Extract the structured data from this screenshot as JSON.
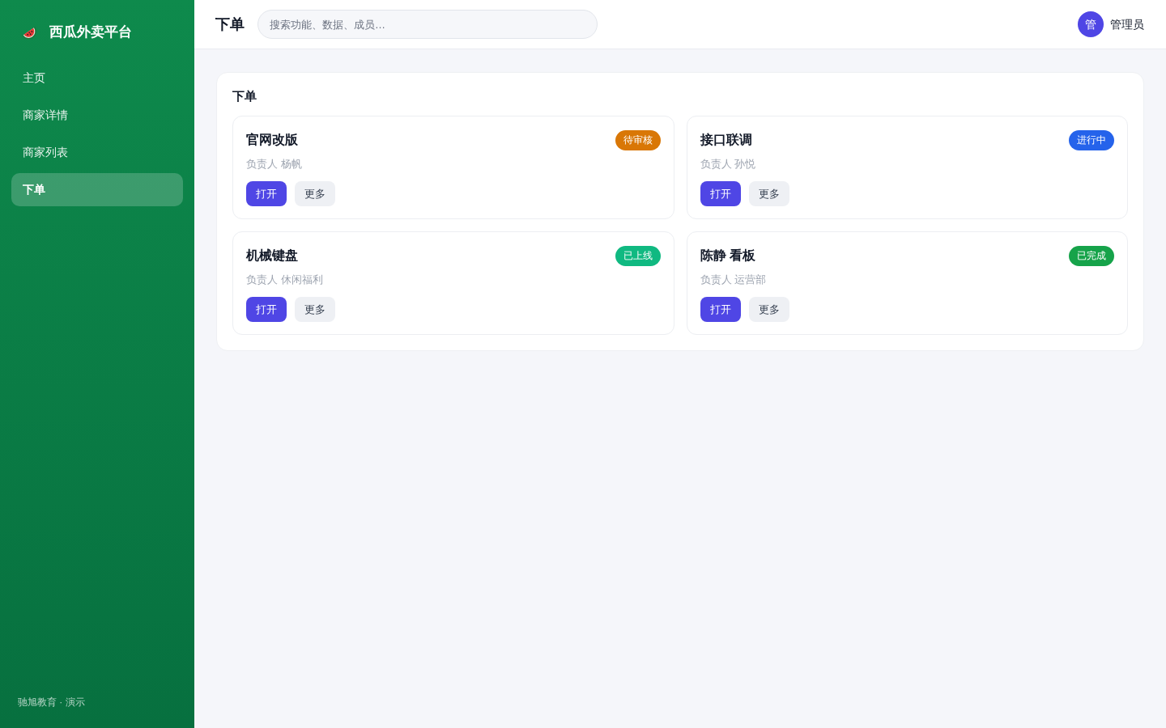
{
  "sidebar": {
    "brand": "西瓜外卖平台",
    "nav": [
      {
        "label": "主页",
        "selected": false
      },
      {
        "label": "商家详情",
        "selected": false
      },
      {
        "label": "商家列表",
        "selected": false
      },
      {
        "label": "下单",
        "selected": true
      }
    ],
    "footer": "驰旭教育 · 演示"
  },
  "header": {
    "title": "下单",
    "search": {
      "placeholder": "搜索功能、数据、成员…"
    },
    "user": {
      "avatar": "管",
      "name": "管理员"
    }
  },
  "panel": {
    "title": "下单",
    "cards": [
      {
        "title": "官网改版",
        "badge": {
          "label": "待审核",
          "color": "#d97706"
        },
        "owner": "负责人 杨帆",
        "actions": [
          {
            "label": "打开",
            "kind": "primary"
          },
          {
            "label": "更多",
            "kind": "secondary"
          }
        ]
      },
      {
        "title": "接口联调",
        "badge": {
          "label": "进行中",
          "color": "#2563eb"
        },
        "owner": "负责人 孙悦",
        "actions": [
          {
            "label": "打开",
            "kind": "primary"
          },
          {
            "label": "更多",
            "kind": "secondary"
          }
        ]
      },
      {
        "title": "机械键盘",
        "badge": {
          "label": "已上线",
          "color": "#10b981"
        },
        "owner": "负责人 休闲福利",
        "actions": [
          {
            "label": "打开",
            "kind": "primary"
          },
          {
            "label": "更多",
            "kind": "secondary"
          }
        ]
      },
      {
        "title": "陈静 看板",
        "badge": {
          "label": "已完成",
          "color": "#16a34a"
        },
        "owner": "负责人 运营部",
        "actions": [
          {
            "label": "打开",
            "kind": "primary"
          },
          {
            "label": "更多",
            "kind": "secondary"
          }
        ]
      }
    ]
  }
}
